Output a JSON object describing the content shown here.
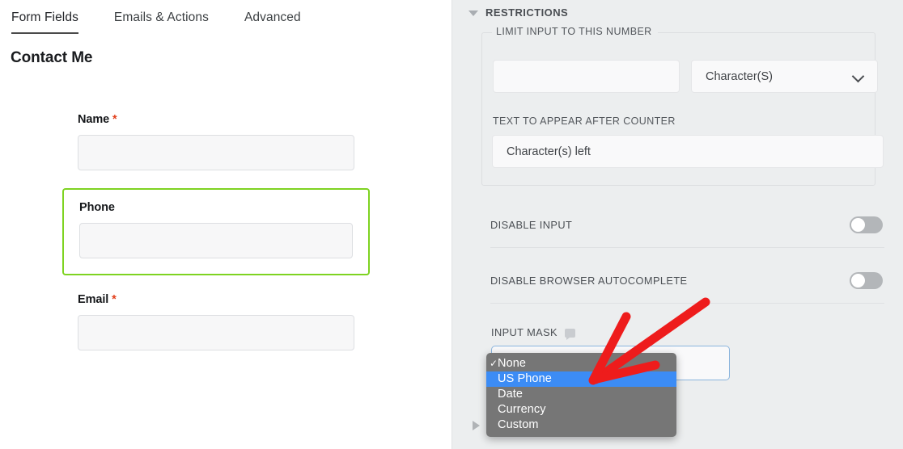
{
  "left_panel": {
    "tabs": [
      {
        "label": "Form Fields",
        "active": true
      },
      {
        "label": "Emails & Actions",
        "active": false
      },
      {
        "label": "Advanced",
        "active": false
      }
    ],
    "form_title": "Contact Me",
    "fields": [
      {
        "label": "Name",
        "required_marker": "*",
        "value": "",
        "selected": false
      },
      {
        "label": "Phone",
        "required_marker": "",
        "value": "",
        "selected": true
      },
      {
        "label": "Email",
        "required_marker": "*",
        "value": "",
        "selected": false
      }
    ]
  },
  "right_panel": {
    "section_title": "RESTRICTIONS",
    "collapse_icon": "caret-down-icon",
    "limit_fieldset": {
      "legend": "LIMIT INPUT TO THIS NUMBER",
      "number_value": "",
      "unit_selected": "Character(S)",
      "unit_icon": "chevron-down-icon",
      "counter_text_label": "TEXT TO APPEAR AFTER COUNTER",
      "counter_text_value": "Character(s) left"
    },
    "toggles": [
      {
        "label": "DISABLE INPUT",
        "on": false
      },
      {
        "label": "DISABLE BROWSER AUTOCOMPLETE",
        "on": false
      }
    ],
    "input_mask": {
      "label": "INPUT MASK",
      "tooltip_icon": "speech-bubble-tooltip-icon",
      "value": "",
      "dropdown_open": true,
      "options": [
        {
          "label": "None",
          "checked": true,
          "highlighted": false
        },
        {
          "label": "US Phone",
          "checked": false,
          "highlighted": true
        },
        {
          "label": "Date",
          "checked": false,
          "highlighted": false
        },
        {
          "label": "Currency",
          "checked": false,
          "highlighted": false
        },
        {
          "label": "Custom",
          "checked": false,
          "highlighted": false
        }
      ],
      "checkmark_glyph": "✓"
    },
    "scroll_arrow_icon": "triangle-right-icon"
  },
  "annotation": {
    "type": "arrow",
    "color": "#ee1c1c",
    "points_to": "US Phone"
  },
  "colors": {
    "selected_field_outline": "#7ed321",
    "required_star": "#e2401c",
    "panel_background": "#eceeef",
    "menu_background": "#767676",
    "menu_highlight": "#3c8cf5",
    "focus_border": "#8ab4dd",
    "annotation_red": "#ee1c1c"
  }
}
